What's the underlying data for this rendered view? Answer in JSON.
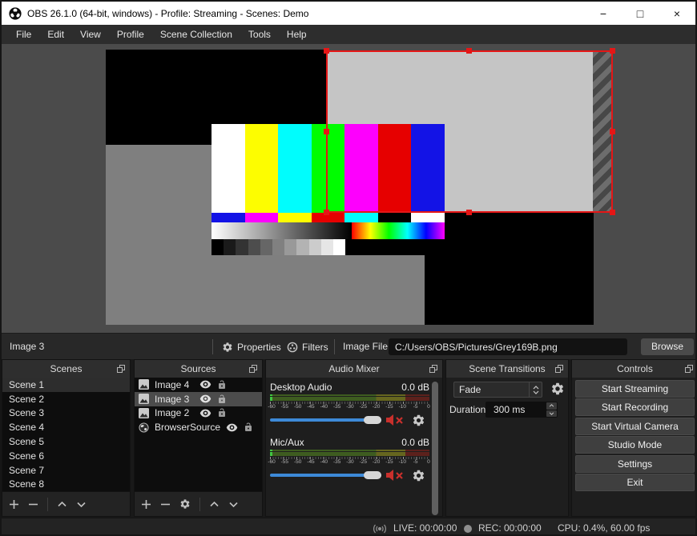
{
  "window": {
    "title": "OBS 26.1.0 (64-bit, windows) - Profile: Streaming - Scenes: Demo",
    "minimize": "−",
    "maximize": "□",
    "close": "×"
  },
  "menu": {
    "items": [
      "File",
      "Edit",
      "View",
      "Profile",
      "Scene Collection",
      "Tools",
      "Help"
    ]
  },
  "source_toolbar": {
    "selected_source": "Image 3",
    "properties": "Properties",
    "filters": "Filters",
    "image_file_label": "Image File",
    "image_file_path": "C:/Users/OBS/Pictures/Grey169B.png",
    "browse": "Browse"
  },
  "scenes": {
    "title": "Scenes",
    "items": [
      "Scene 1",
      "Scene 2",
      "Scene 3",
      "Scene 4",
      "Scene 5",
      "Scene 6",
      "Scene 7",
      "Scene 8"
    ],
    "selected": "Scene 1"
  },
  "sources": {
    "title": "Sources",
    "items": [
      {
        "name": "Image 4",
        "type": "image"
      },
      {
        "name": "Image 3",
        "type": "image"
      },
      {
        "name": "Image 2",
        "type": "image"
      },
      {
        "name": "BrowserSource",
        "type": "browser"
      }
    ],
    "selected": "Image 3"
  },
  "mixer": {
    "title": "Audio Mixer",
    "scale": [
      "-60",
      "-55",
      "-50",
      "-45",
      "-40",
      "-35",
      "-30",
      "-25",
      "-20",
      "-15",
      "-10",
      "-5",
      "0"
    ],
    "channels": [
      {
        "name": "Desktop Audio",
        "db": "0.0 dB"
      },
      {
        "name": "Mic/Aux",
        "db": "0.0 dB"
      }
    ]
  },
  "transitions": {
    "title": "Scene Transitions",
    "selected": "Fade",
    "duration_label": "Duration",
    "duration": "300 ms"
  },
  "controls": {
    "title": "Controls",
    "buttons": [
      "Start Streaming",
      "Start Recording",
      "Start Virtual Camera",
      "Studio Mode",
      "Settings",
      "Exit"
    ]
  },
  "status": {
    "live": "LIVE: 00:00:00",
    "rec": "REC: 00:00:00",
    "cpu": "CPU: 0.4%, 60.00 fps"
  },
  "colors": {
    "accent_blue": "#3d8ad8",
    "selection_red": "#e51616",
    "mute_red": "#c9302c",
    "meter_green_dim": "#3e5c20",
    "meter_yellow_dim": "#66661f",
    "meter_red_dim": "#5c211c",
    "meter_green_lit": "#41c541",
    "preview_bg": "#4b4b4b",
    "canvas_gray": "#7f7f7f",
    "selected_image_gray": "#c5c5c5"
  }
}
